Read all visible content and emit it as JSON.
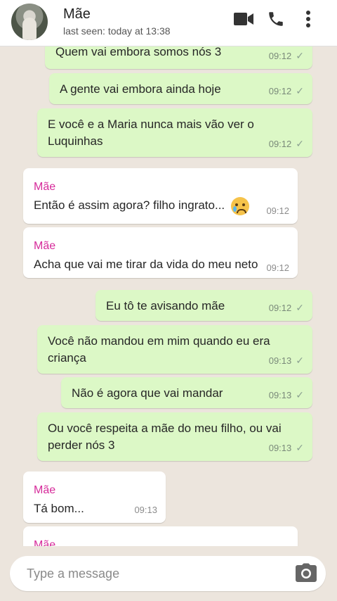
{
  "header": {
    "name": "Mãe",
    "status": "last seen: today at 13:38",
    "icons": [
      "avatar",
      "video-camera-icon",
      "phone-icon",
      "more-vert-icon"
    ]
  },
  "messages": [
    {
      "dir": "out",
      "text": "Quem vai embora somos nós 3",
      "time": "09:12",
      "ticks": "✓"
    },
    {
      "dir": "out",
      "text": "A gente vai embora ainda hoje",
      "time": "09:12",
      "ticks": "✓"
    },
    {
      "dir": "out",
      "text_line1": "E você e a Maria nunca mais vão ver o",
      "text_line2": "Luquinhas",
      "time": "09:12",
      "ticks": "✓"
    },
    {
      "dir": "in",
      "sender": "Mãe",
      "text": "Então é assim agora? filho ingrato...",
      "emoji": "crying-face",
      "time": "09:12"
    },
    {
      "dir": "in",
      "sender": "Mãe",
      "text": "Acha que vai me tirar da vida do meu neto",
      "time": "09:12"
    },
    {
      "dir": "out",
      "text": "Eu tô te avisando mãe",
      "time": "09:12",
      "ticks": "✓"
    },
    {
      "dir": "out",
      "text_line1": "Você não mandou em mim quando eu era",
      "text_line2": "criança",
      "time": "09:13",
      "ticks": "✓"
    },
    {
      "dir": "out",
      "text": "Não é agora que vai mandar",
      "time": "09:13",
      "ticks": "✓"
    },
    {
      "dir": "out",
      "text_line1": "Ou você respeita a mãe do meu filho, ou vai",
      "text_line2": "perder nós 3",
      "time": "09:13",
      "ticks": "✓"
    },
    {
      "dir": "in",
      "sender": "Mãe",
      "text": "Tá bom...",
      "time": "09:13"
    },
    {
      "dir": "in",
      "sender": "Mãe"
    }
  ],
  "composer": {
    "placeholder": "Type a message",
    "icon": "camera-icon"
  },
  "colors": {
    "outgoing_bubble": "#dcf8c6",
    "incoming_bubble": "#ffffff",
    "sender_name": "#d62a9a",
    "chat_background": "#ece5dd"
  }
}
